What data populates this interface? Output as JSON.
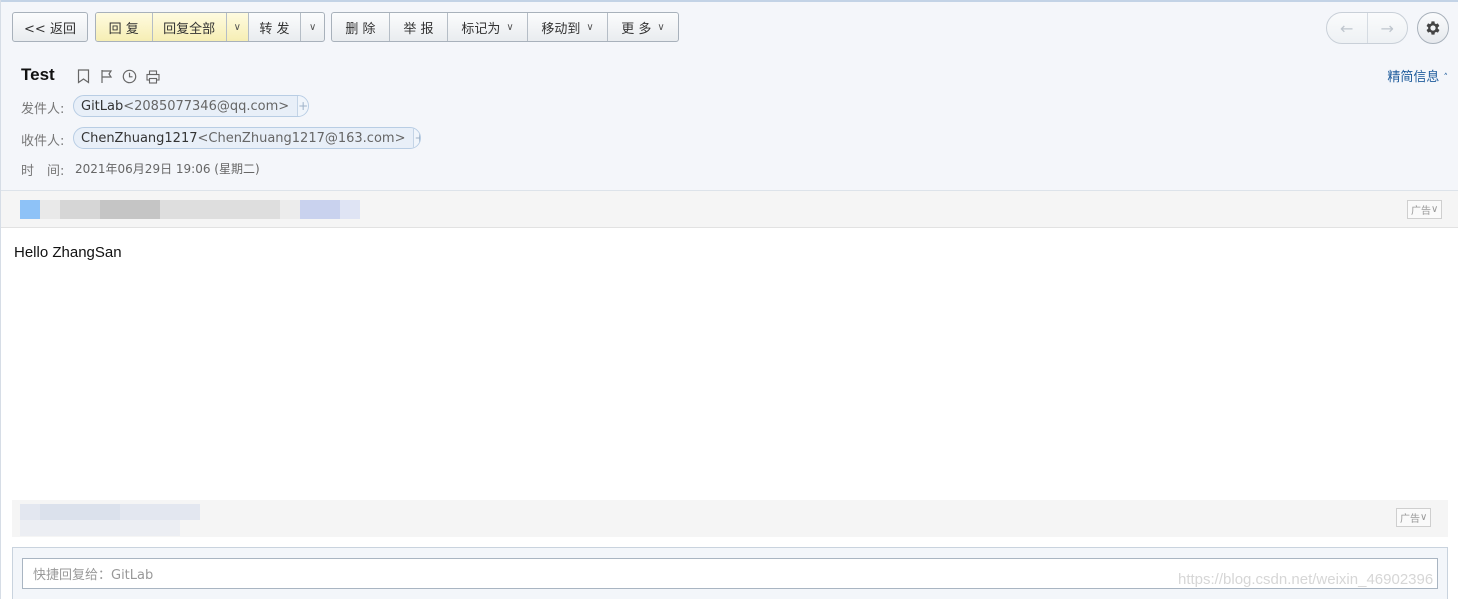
{
  "toolbar": {
    "back_label": "<< 返回",
    "reply_label": "回 复",
    "reply_all_label": "回复全部",
    "forward_label": "转 发",
    "delete_label": "删 除",
    "report_label": "举 报",
    "mark_as_label": "标记为",
    "move_to_label": "移动到",
    "more_label": "更 多",
    "prev_icon": "left-arrow-icon",
    "next_icon": "right-arrow-icon",
    "settings_icon": "gear-icon"
  },
  "mail": {
    "subject": "Test",
    "brief_info_label": "精简信息",
    "from_label": "发件人:",
    "from_name": "GitLab",
    "from_email": "<2085077346@qq.com>",
    "to_label": "收件人:",
    "to_name": "ChenZhuang1217",
    "to_email": "<ChenZhuang1217@163.com>",
    "time_label": "时　间:",
    "time_value": "2021年06月29日 19:06 (星期二)",
    "body": "Hello ZhangSan"
  },
  "ads": {
    "ad_tag": "广告"
  },
  "quick_reply": {
    "placeholder": "快捷回复给：GitLab"
  },
  "watermark": "https://blog.csdn.net/weixin_46902396",
  "colors": {
    "header_bg": "#f4f6fa",
    "reply_highlight": "#f6eeb4",
    "link_blue": "#1f5c9c",
    "chip_bg": "#e8eff8"
  }
}
